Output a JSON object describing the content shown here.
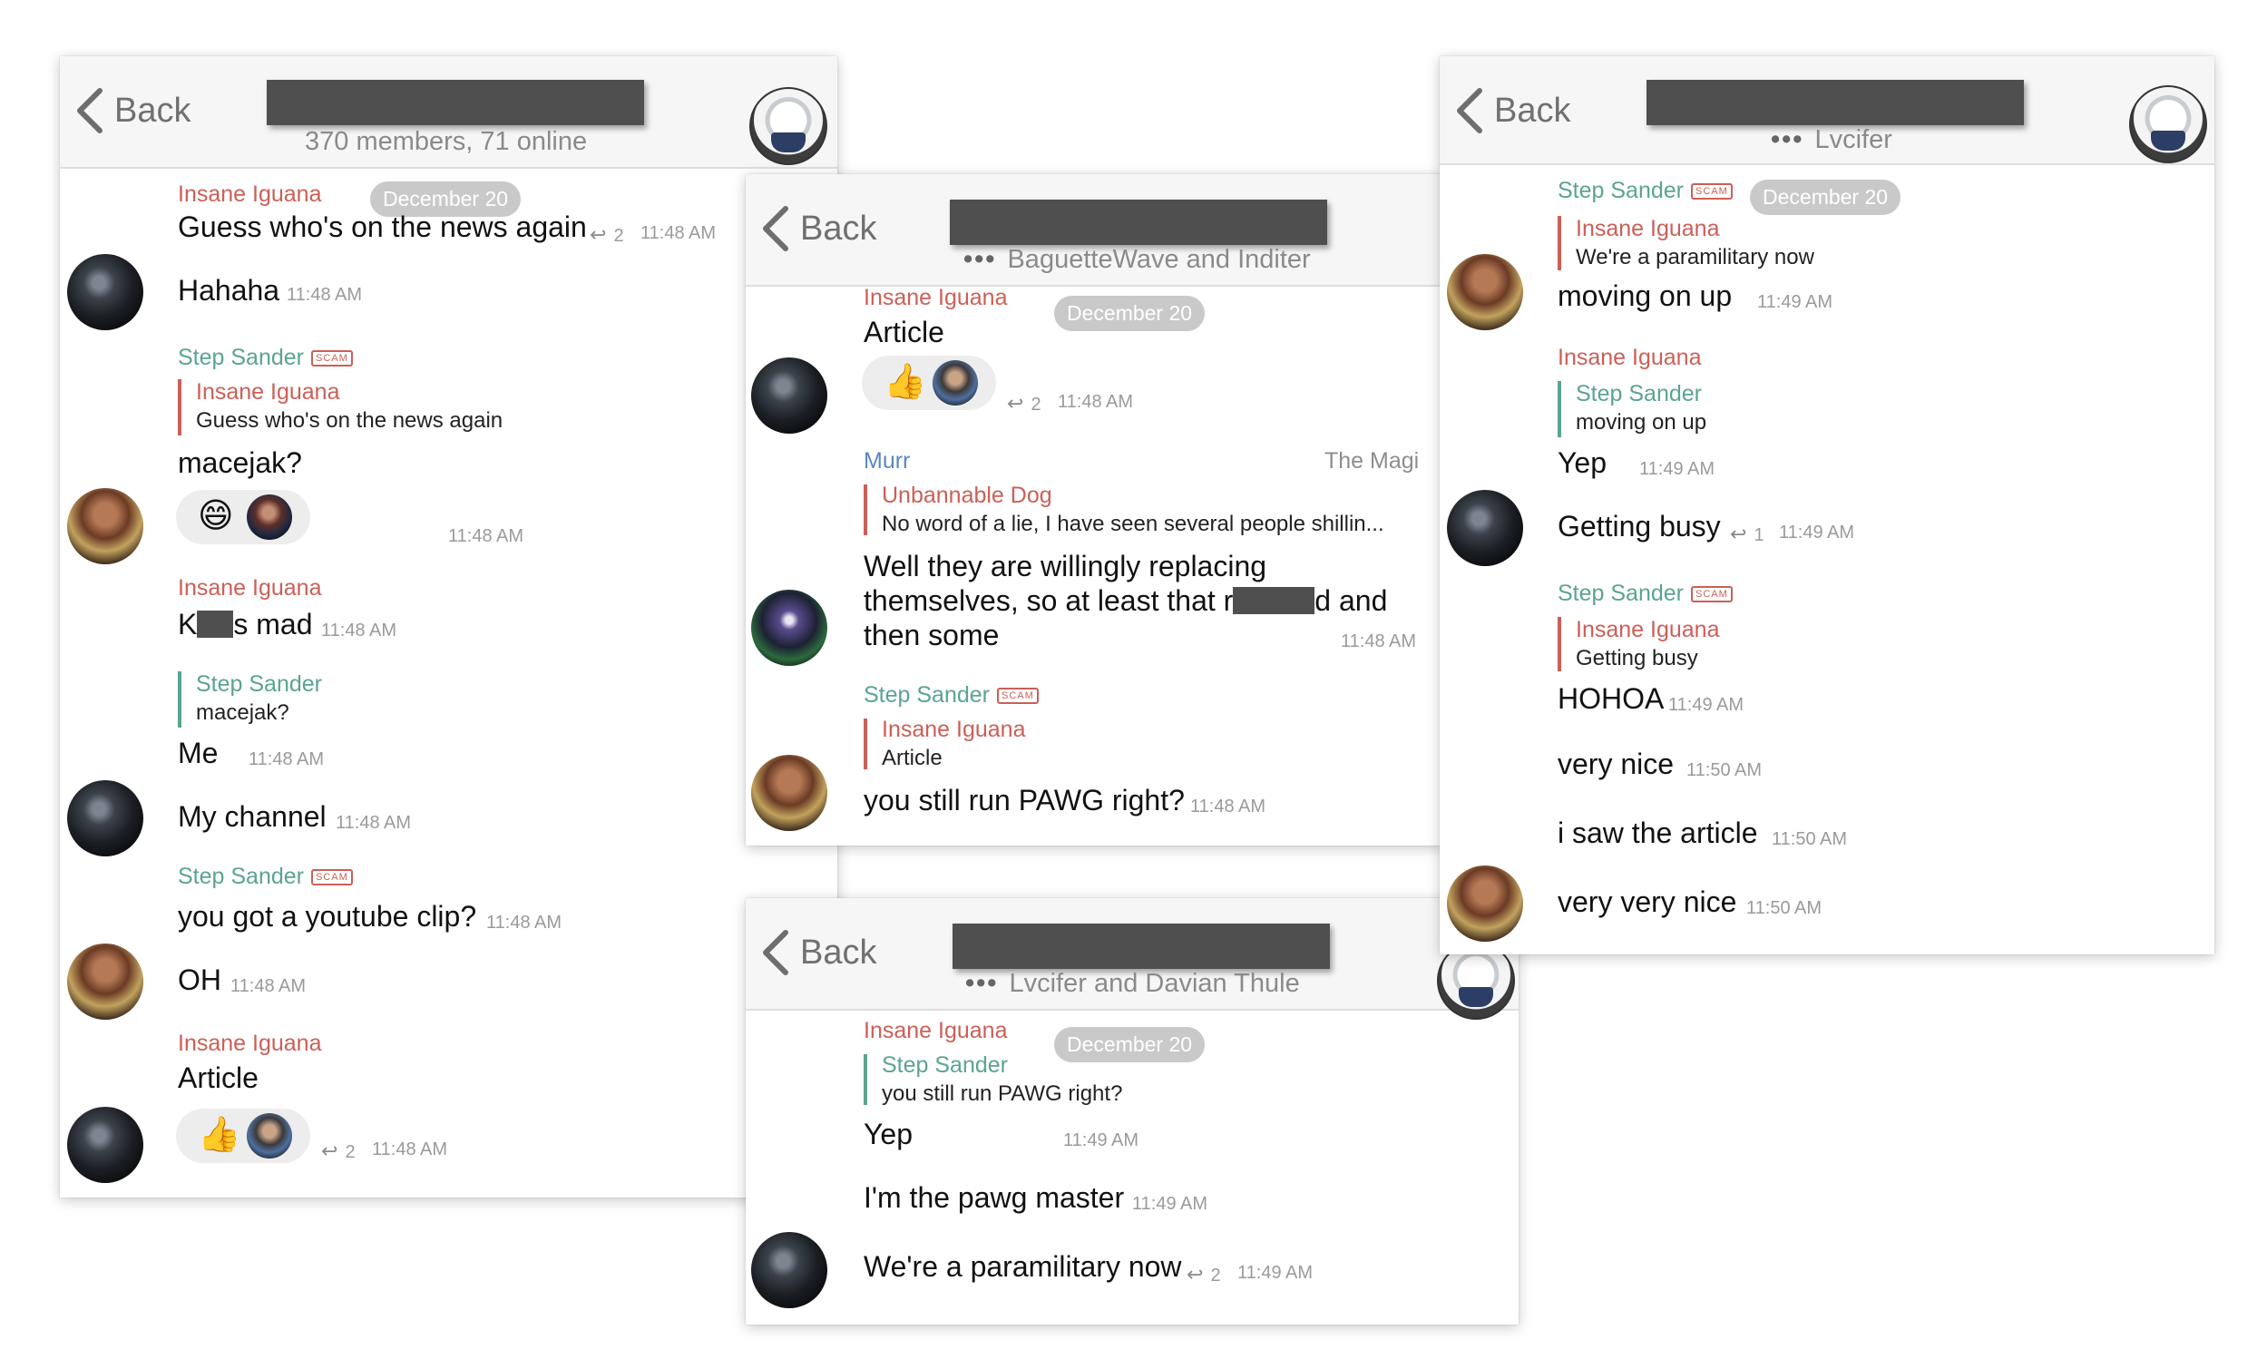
{
  "panel1": {
    "back": "Back",
    "subtitle": "370 members, 71 online",
    "date": "December 20",
    "m1_name": "Insane Iguana",
    "m1_text": "Guess who's on the news again",
    "m1_count": "2",
    "m1_time": "11:48 AM",
    "m2_text": "Hahaha",
    "m2_time": "11:48 AM",
    "m3_name": "Step Sander",
    "m3_badge": "SCAM",
    "m3_qname": "Insane Iguana",
    "m3_qtext": "Guess who's on the news again",
    "m3_text": "macejak?",
    "m3_emoji": "😄",
    "m3_time": "11:48 AM",
    "m4_name": "Insane Iguana",
    "m4_pre": "K",
    "m4_post": "s mad",
    "m4_time": "11:48 AM",
    "m5_qname": "Step Sander",
    "m5_qtext": "macejak?",
    "m5_text": "Me",
    "m5_time": "11:48 AM",
    "m6_text": "My channel",
    "m6_time": "11:48 AM",
    "m7_name": "Step Sander",
    "m7_badge": "SCAM",
    "m7_text": "you got a youtube clip?",
    "m7_time": "11:48 AM",
    "m8_text": "OH",
    "m8_time": "11:48 AM",
    "m9_name": "Insane Iguana",
    "m9_text": "Article",
    "m9_emoji": "👍",
    "m9_count": "2",
    "m9_time": "11:48 AM"
  },
  "panel2": {
    "back": "Back",
    "subtitle": "BaguetteWave and Inditer",
    "date": "December 20",
    "m1_name": "Insane Iguana",
    "m1_text": "Article",
    "m1_emoji": "👍",
    "m1_count": "2",
    "m1_time": "11:48 AM",
    "m2_name": "Murr",
    "m2_title": "The Magi",
    "m2_qname": "Unbannable Dog",
    "m2_qtext": "No word of a lie, I have seen several people shillin...",
    "m2_line1": "Well they are willingly replacing",
    "m2_line2_pre": "themselves, so at least that r",
    "m2_line2_post": "d and",
    "m2_line3": "then some",
    "m2_time": "11:48 AM",
    "m3_name": "Step Sander",
    "m3_badge": "SCAM",
    "m3_qname": "Insane Iguana",
    "m3_qtext": "Article",
    "m3_text": "you still run PAWG right?",
    "m3_time": "11:48 AM"
  },
  "panel3": {
    "back": "Back",
    "subtitle": "Lvcifer and Davian Thule",
    "date": "December 20",
    "m1_name": "Insane Iguana",
    "m1_qname": "Step Sander",
    "m1_qtext": "you still run PAWG right?",
    "m1_text": "Yep",
    "m1_time": "11:49 AM",
    "m2_text": "I'm the pawg master",
    "m2_time": "11:49 AM",
    "m3_text": "We're a paramilitary now",
    "m3_count": "2",
    "m3_time": "11:49 AM"
  },
  "panel4": {
    "back": "Back",
    "subtitle": "Lvcifer",
    "date": "December 20",
    "m1_name": "Step Sander",
    "m1_badge": "SCAM",
    "m1_qname": "Insane Iguana",
    "m1_qtext": "We're a paramilitary now",
    "m1_text": "moving on up",
    "m1_time": "11:49 AM",
    "m2_name": "Insane Iguana",
    "m2_qname": "Step Sander",
    "m2_qtext": "moving on up",
    "m2_text": "Yep",
    "m2_time": "11:49 AM",
    "m3_text": "Getting busy",
    "m3_count": "1",
    "m3_time": "11:49 AM",
    "m4_name": "Step Sander",
    "m4_badge": "SCAM",
    "m4_qname": "Insane Iguana",
    "m4_qtext": "Getting busy",
    "m4_text": "HOHOA",
    "m4_time": "11:49 AM",
    "m5_text": "very nice",
    "m5_time": "11:50 AM",
    "m6_text": "i saw the article",
    "m6_time": "11:50 AM",
    "m7_text": "very very nice",
    "m7_time": "11:50 AM"
  }
}
